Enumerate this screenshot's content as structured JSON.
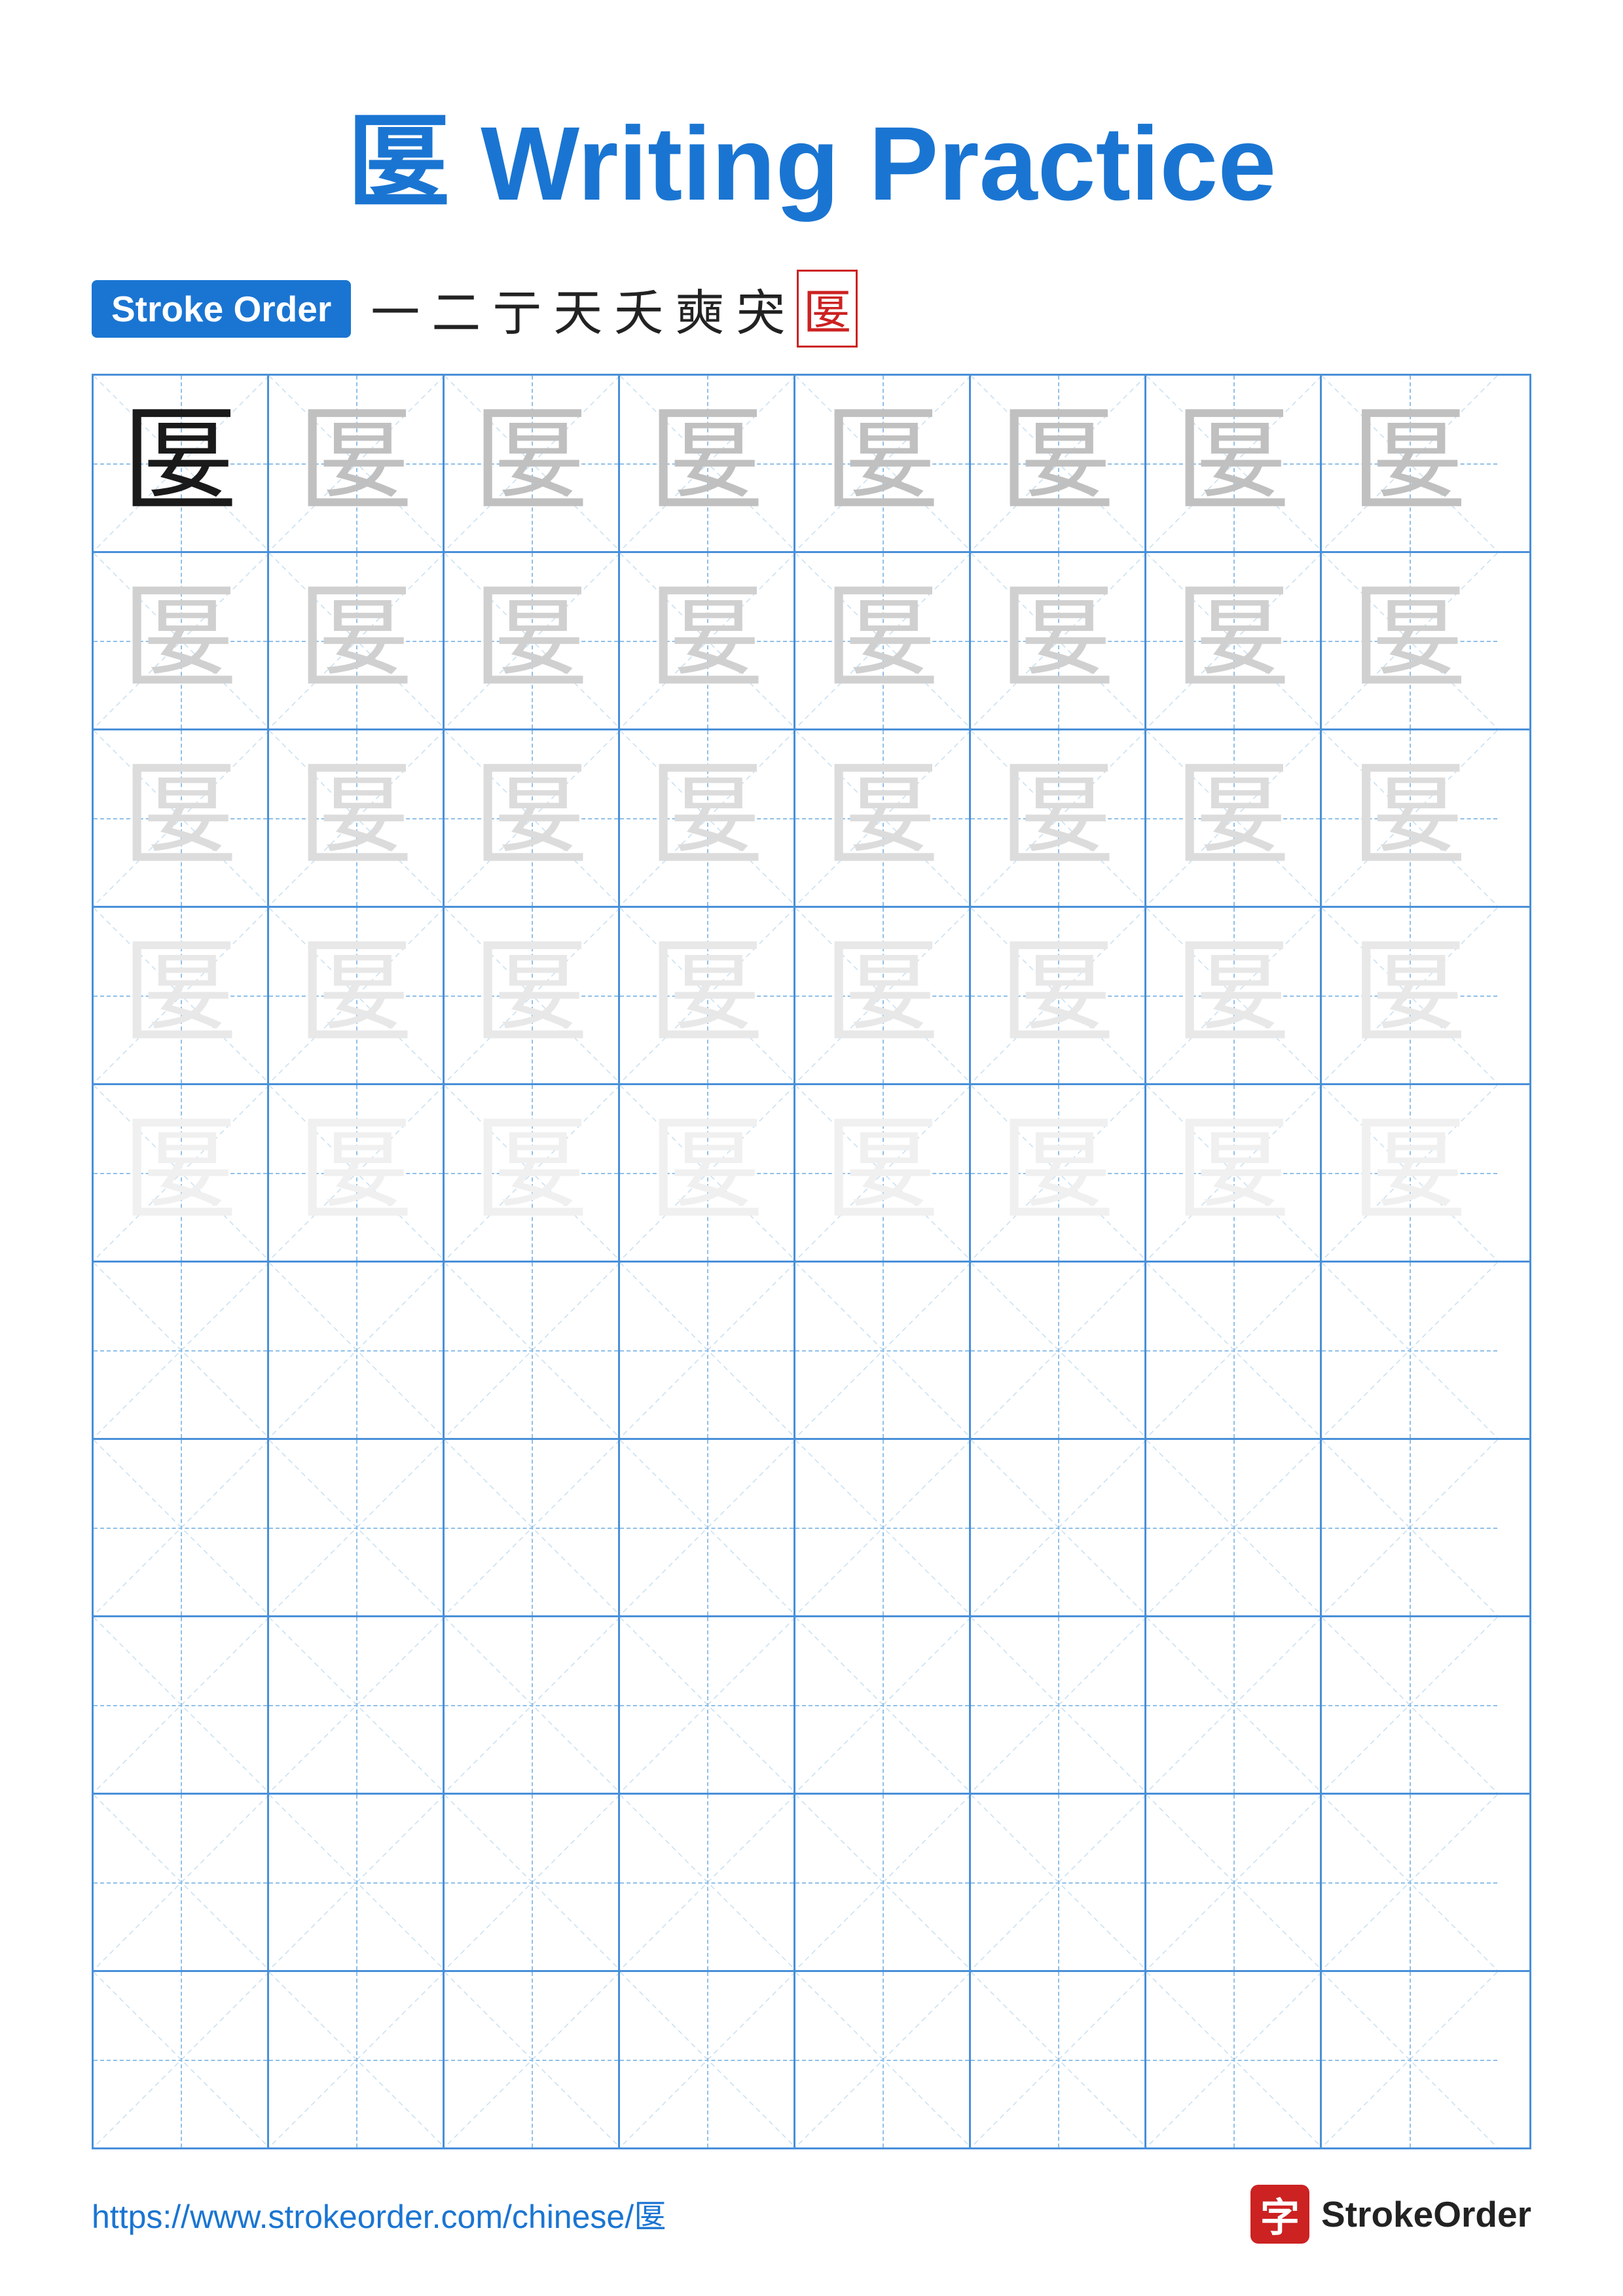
{
  "title": {
    "char": "匽",
    "text": "Writing Practice"
  },
  "stroke_order": {
    "badge_label": "Stroke Order",
    "strokes": [
      "一",
      "二",
      "亍",
      "天",
      "夭",
      "奭",
      "宊",
      "匽"
    ],
    "last_stroke_special": true
  },
  "grid": {
    "rows": 10,
    "cols": 8,
    "character": "匽",
    "guide_char_rows": 5,
    "empty_rows": 5
  },
  "footer": {
    "url": "https://www.strokeorder.com/chinese/匽",
    "logo_char": "字",
    "logo_text": "StrokeOrder"
  }
}
